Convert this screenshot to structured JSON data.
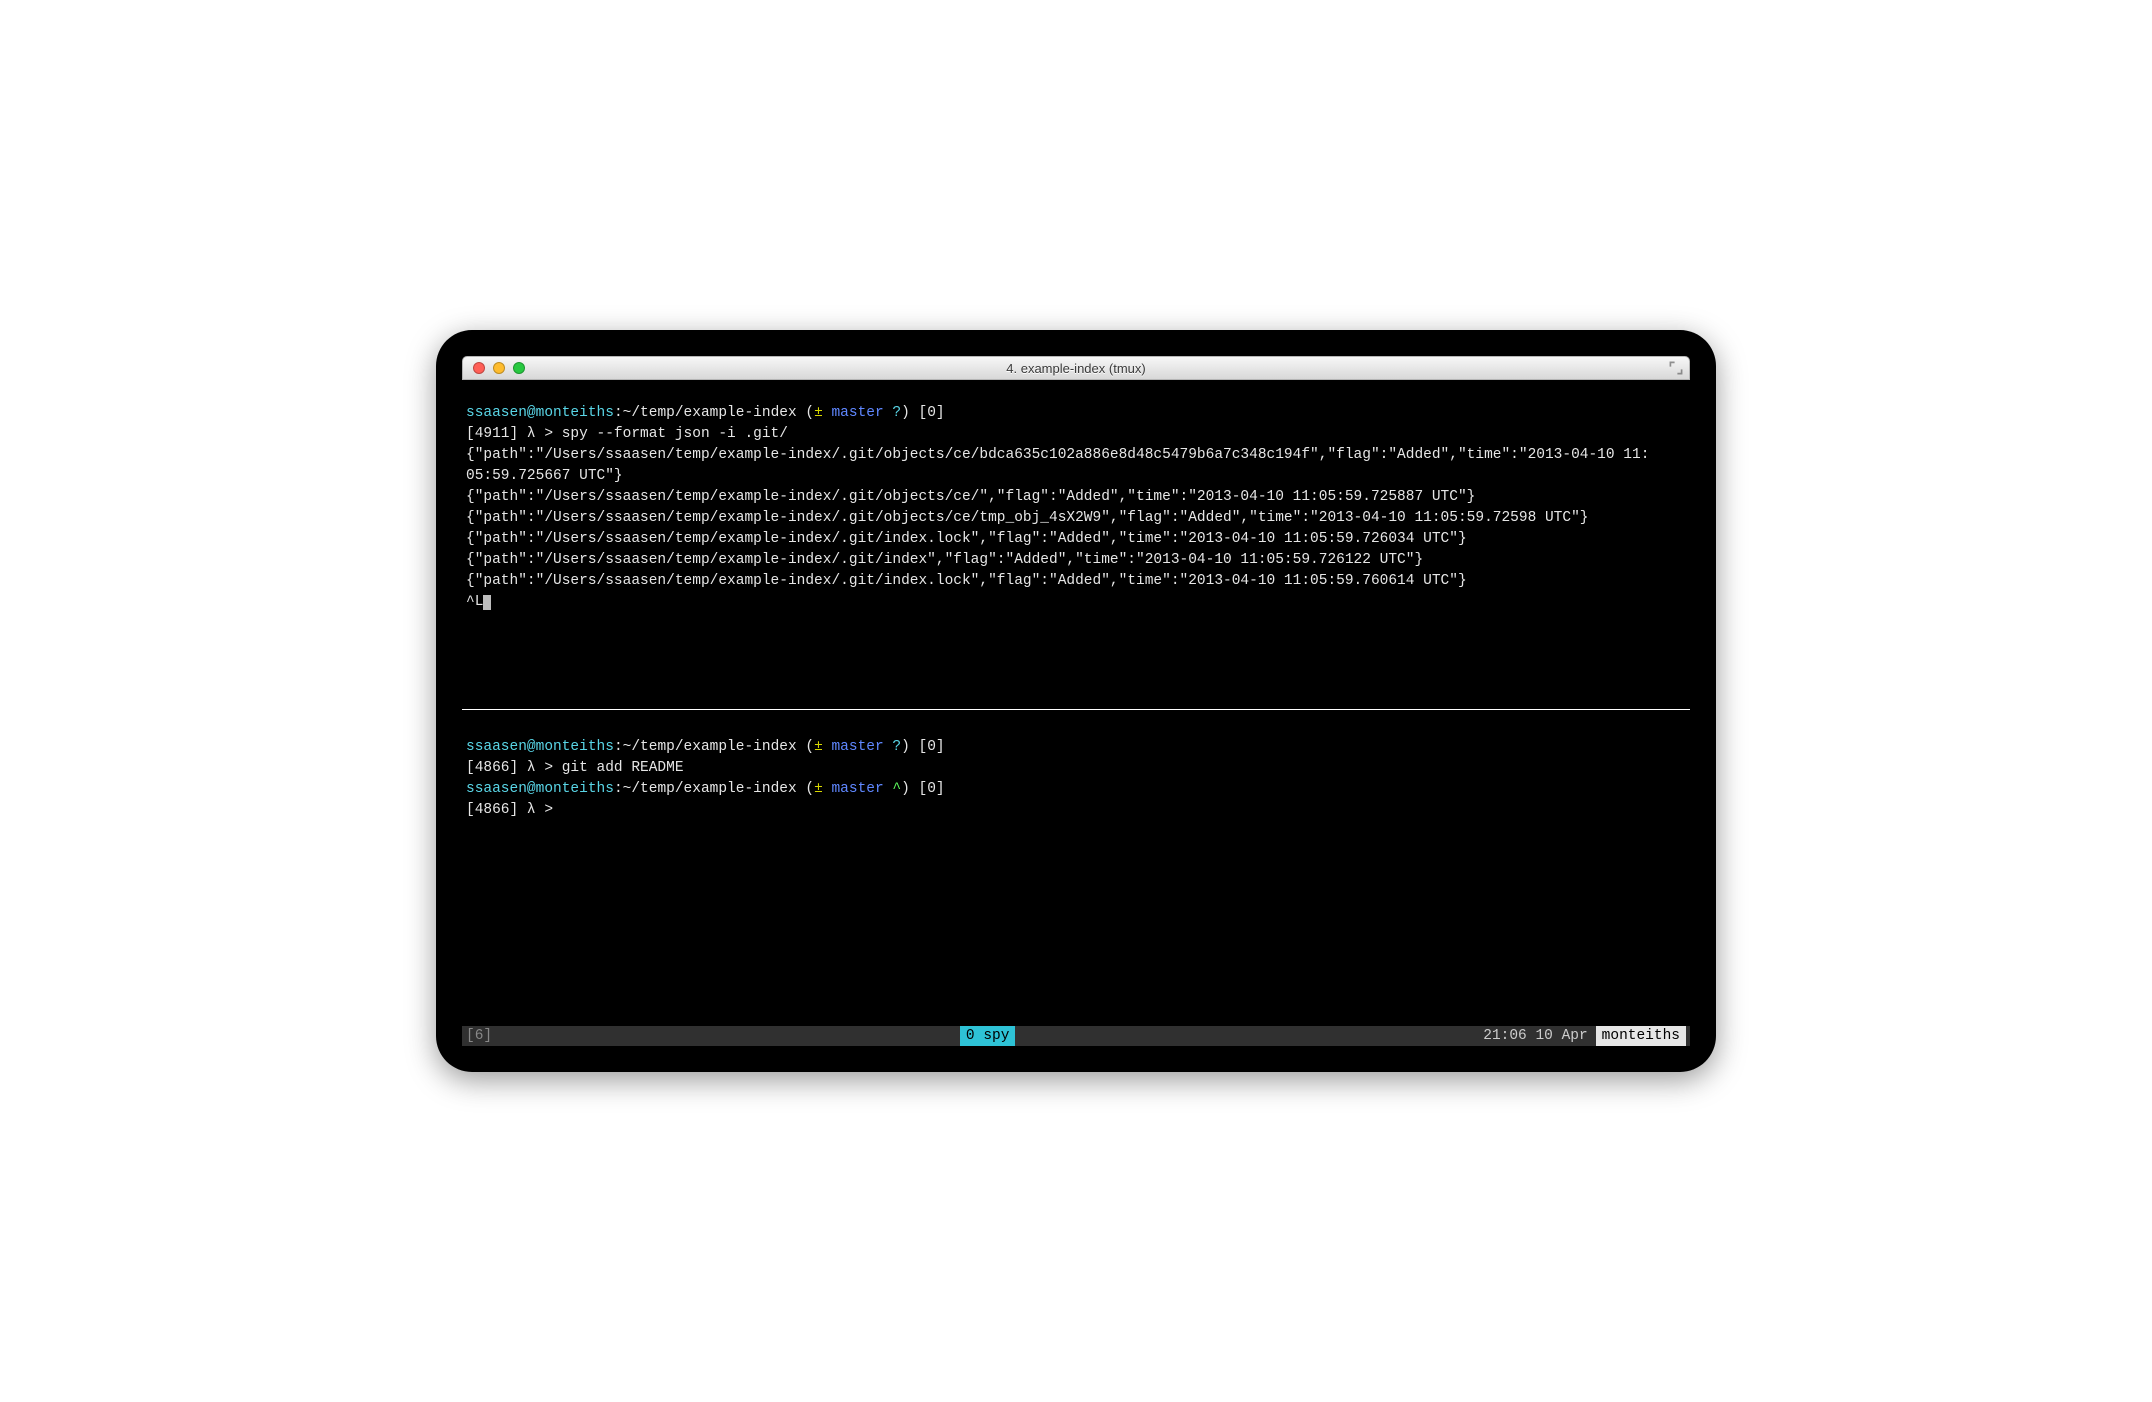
{
  "window": {
    "title": "4. example-index (tmux)"
  },
  "top_pane": {
    "prompt": {
      "user_host": "ssaasen@monteiths",
      "path": ":~/temp/example-index ",
      "git_open": "(",
      "git_pm": "±",
      "git_branch": " master ",
      "git_status": "?",
      "git_close": ")",
      "trail": " [0]"
    },
    "cmd_prefix": "[4911] λ > ",
    "cmd": "spy --format json -i .git/",
    "out1": "{\"path\":\"/Users/ssaasen/temp/example-index/.git/objects/ce/bdca635c102a886e8d48c5479b6a7c348c194f\",\"flag\":\"Added\",\"time\":\"2013-04-10 11:",
    "out1b": "05:59.725667 UTC\"}",
    "out2": "{\"path\":\"/Users/ssaasen/temp/example-index/.git/objects/ce/\",\"flag\":\"Added\",\"time\":\"2013-04-10 11:05:59.725887 UTC\"}",
    "out3": "{\"path\":\"/Users/ssaasen/temp/example-index/.git/objects/ce/tmp_obj_4sX2W9\",\"flag\":\"Added\",\"time\":\"2013-04-10 11:05:59.72598 UTC\"}",
    "out4": "{\"path\":\"/Users/ssaasen/temp/example-index/.git/index.lock\",\"flag\":\"Added\",\"time\":\"2013-04-10 11:05:59.726034 UTC\"}",
    "out5": "{\"path\":\"/Users/ssaasen/temp/example-index/.git/index\",\"flag\":\"Added\",\"time\":\"2013-04-10 11:05:59.726122 UTC\"}",
    "out6": "{\"path\":\"/Users/ssaasen/temp/example-index/.git/index.lock\",\"flag\":\"Added\",\"time\":\"2013-04-10 11:05:59.760614 UTC\"}",
    "ctrl": "^L"
  },
  "bottom_pane": {
    "prompt1": {
      "user_host": "ssaasen@monteiths",
      "path": ":~/temp/example-index ",
      "git_open": "(",
      "git_pm": "±",
      "git_branch": " master ",
      "git_status": "?",
      "git_close": ")",
      "trail": " [0]"
    },
    "cmd1_prefix": "[4866] λ > ",
    "cmd1": "git add README",
    "prompt2": {
      "user_host": "ssaasen@monteiths",
      "path": ":~/temp/example-index ",
      "git_open": "(",
      "git_pm": "±",
      "git_branch": " master ",
      "git_status": "^",
      "git_close": ")",
      "trail": " [0]"
    },
    "cmd2_prefix": "[4866] λ > "
  },
  "status": {
    "session": "[6]",
    "active_window": "0 spy",
    "clock": "21:06 10 Apr",
    "host": "monteiths"
  }
}
